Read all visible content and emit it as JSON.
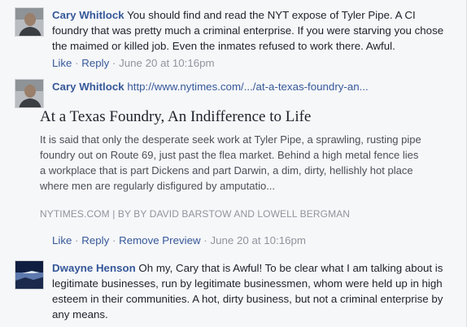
{
  "comments": [
    {
      "author": "Cary Whitlock",
      "text": "You should find and read the NYT expose of Tyler Pipe. A CI foundry that was pretty much a criminal enterprise. If you were starving you chose the maimed or killed job. Even the inmates refused to work there. Awful.",
      "actions": {
        "like": "Like",
        "reply": "Reply",
        "time": "June 20 at 10:16pm"
      }
    },
    {
      "author": "Cary Whitlock",
      "link_text": "http://www.nytimes.com/.../at-a-texas-foundry-an...",
      "preview": {
        "title": "At a Texas Foundry, An Indifference to Life",
        "description": "It is said that only the desperate seek work at Tyler Pipe, a sprawling, rusting pipe foundry out on Route 69, just past the flea market. Behind a high metal fence lies a workplace that is part Dickens and part Darwin, a dim, dirty, hellishly hot place where men are regularly disfigured by amputatio...",
        "source": "NYTIMES.COM | BY BY DAVID BARSTOW AND LOWELL BERGMAN"
      },
      "actions": {
        "like": "Like",
        "reply": "Reply",
        "remove_preview": "Remove Preview",
        "time": "June 20 at 10:16pm"
      }
    },
    {
      "author": "Dwayne Henson",
      "text": "Oh my, Cary that is Awful! To be clear what I am talking about is legitimate businesses, run by legitimate businessmen, whom were held up in high esteem in their communities. A hot, dirty business, but not a criminal enterprise by any means."
    }
  ],
  "separator": "·",
  "colors": {
    "link": "#365899",
    "meta": "#90949c",
    "text": "#1d2129"
  }
}
